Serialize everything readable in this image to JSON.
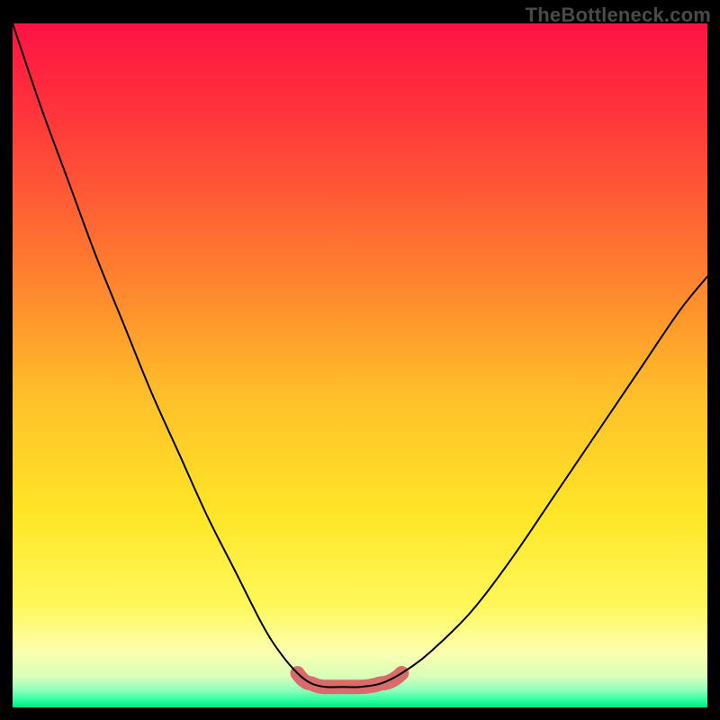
{
  "watermark": "TheBottleneck.com",
  "colors": {
    "frame": "#000000",
    "watermark": "#4a4a4a",
    "curve": "#000000",
    "valley_band": "#d96b6b",
    "gradient_stops": [
      {
        "offset": 0.0,
        "color": "#ff1244"
      },
      {
        "offset": 0.15,
        "color": "#ff3a3a"
      },
      {
        "offset": 0.35,
        "color": "#ff7a2f"
      },
      {
        "offset": 0.55,
        "color": "#ffc129"
      },
      {
        "offset": 0.72,
        "color": "#ffe628"
      },
      {
        "offset": 0.85,
        "color": "#fff85a"
      },
      {
        "offset": 0.92,
        "color": "#fbffb0"
      },
      {
        "offset": 0.955,
        "color": "#d8ffb8"
      },
      {
        "offset": 0.975,
        "color": "#8effbd"
      },
      {
        "offset": 0.99,
        "color": "#28ff9c"
      },
      {
        "offset": 1.0,
        "color": "#00e884"
      }
    ]
  },
  "chart_data": {
    "type": "line",
    "title": "",
    "xlabel": "",
    "ylabel": "",
    "xlim": [
      0,
      100
    ],
    "ylim": [
      0,
      100
    ],
    "note": "Axes are unlabeled; values are normalized estimates read from pixel positions (0 = bottom, 100 = top).",
    "series": [
      {
        "name": "bottleneck-curve",
        "x": [
          0,
          4,
          8,
          12,
          16,
          20,
          24,
          28,
          32,
          36,
          38.5,
          41,
          43,
          45,
          47.5,
          50,
          53,
          56,
          60,
          66,
          72,
          78,
          84,
          90,
          96,
          100
        ],
        "y": [
          100,
          88,
          77,
          66,
          56,
          46,
          37,
          28,
          20,
          12,
          8,
          5,
          3.5,
          3,
          3,
          3,
          3.5,
          5,
          8,
          14,
          22,
          31,
          40,
          49,
          58,
          63
        ]
      }
    ],
    "annotations": [
      {
        "name": "valley-highlight",
        "x_range": [
          41,
          56
        ],
        "y": 3,
        "description": "Thick horizontal pink/red band marking the low-bottleneck region at the curve minimum"
      }
    ]
  }
}
